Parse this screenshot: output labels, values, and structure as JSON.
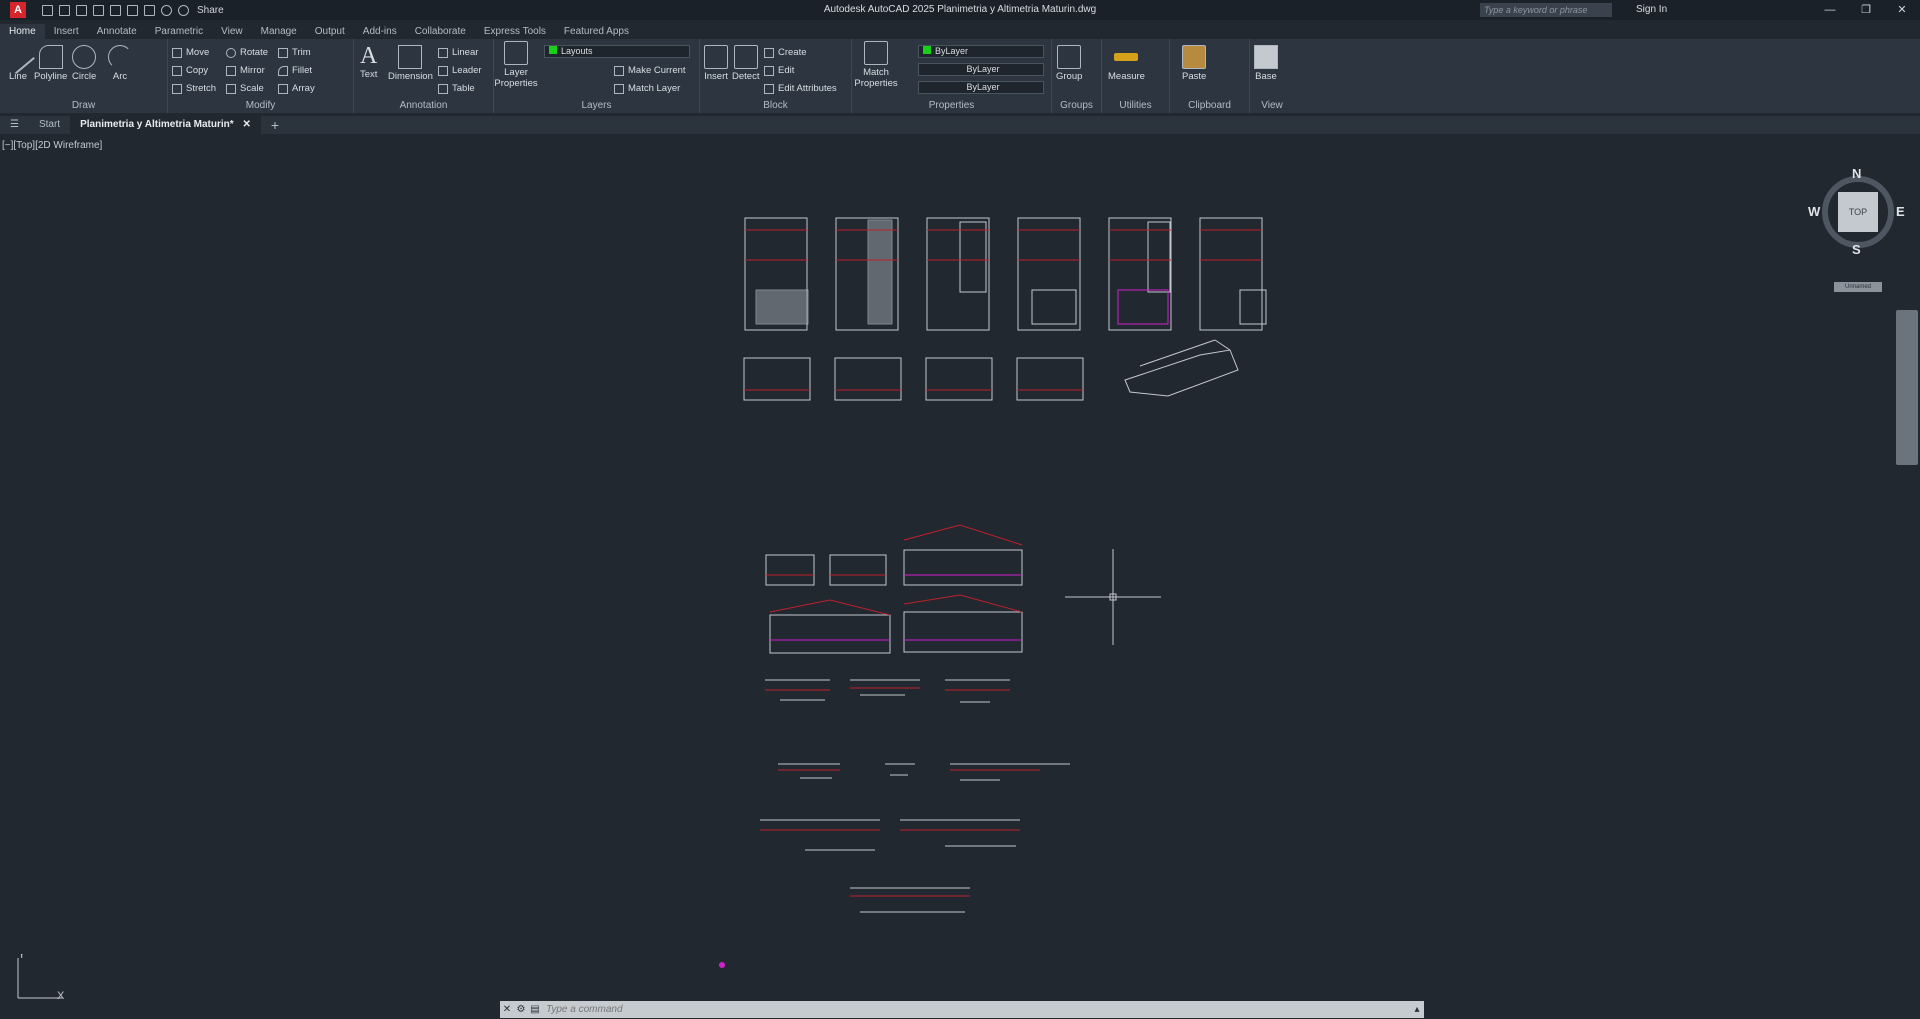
{
  "app": {
    "logo": "A",
    "title": "Autodesk AutoCAD 2025    Planimetria y Altimetria Maturin.dwg",
    "share_label": "Share",
    "search_placeholder": "Type a keyword or phrase",
    "signin_label": "Sign In"
  },
  "ribbon_tabs": [
    "Home",
    "Insert",
    "Annotate",
    "Parametric",
    "View",
    "Manage",
    "Output",
    "Add-ins",
    "Collaborate",
    "Express Tools",
    "Featured Apps"
  ],
  "panels": {
    "draw": {
      "label": "Draw",
      "tools": [
        "Line",
        "Polyline",
        "Circle",
        "Arc"
      ]
    },
    "modify": {
      "label": "Modify",
      "items": [
        "Move",
        "Rotate",
        "Trim",
        "Copy",
        "Mirror",
        "Fillet",
        "Stretch",
        "Scale",
        "Array"
      ]
    },
    "annotation": {
      "label": "Annotation",
      "tools": [
        "Text",
        "Dimension"
      ],
      "items": [
        "Linear",
        "Leader",
        "Table"
      ]
    },
    "layers": {
      "label": "Layers",
      "tool": "Layer Properties",
      "current_layer": "Layouts",
      "items": [
        "Make Current",
        "Match Layer"
      ]
    },
    "block": {
      "label": "Block",
      "tools": [
        "Insert",
        "Detect"
      ],
      "items": [
        "Create",
        "Edit",
        "Edit Attributes"
      ]
    },
    "properties": {
      "label": "Properties",
      "tool": "Match Properties",
      "color": "ByLayer",
      "linetype": "ByLayer",
      "lineweight": "ByLayer"
    },
    "groups": {
      "label": "Groups",
      "tool": "Group"
    },
    "utilities": {
      "label": "Utilities",
      "tool": "Measure"
    },
    "clipboard": {
      "label": "Clipboard",
      "tool": "Paste"
    },
    "view": {
      "label": "View",
      "tool": "Base"
    }
  },
  "doc_tabs": {
    "start": "Start",
    "active": "Planimetria y Altimetria Maturin*"
  },
  "viewport_label": "[−][Top][2D Wireframe]",
  "viewcube": {
    "face": "TOP",
    "north": "N",
    "south": "S",
    "east": "E",
    "west": "W",
    "ucs": "Unnamed"
  },
  "ucs_axes": {
    "x": "X",
    "y": "Y"
  },
  "command": {
    "placeholder": "Type a command"
  },
  "colors": {
    "background": "#212830",
    "ribbon": "#2d3640",
    "accent_red": "#c0202a",
    "accent_magenta": "#d020d0",
    "layer_green": "#18d018"
  }
}
